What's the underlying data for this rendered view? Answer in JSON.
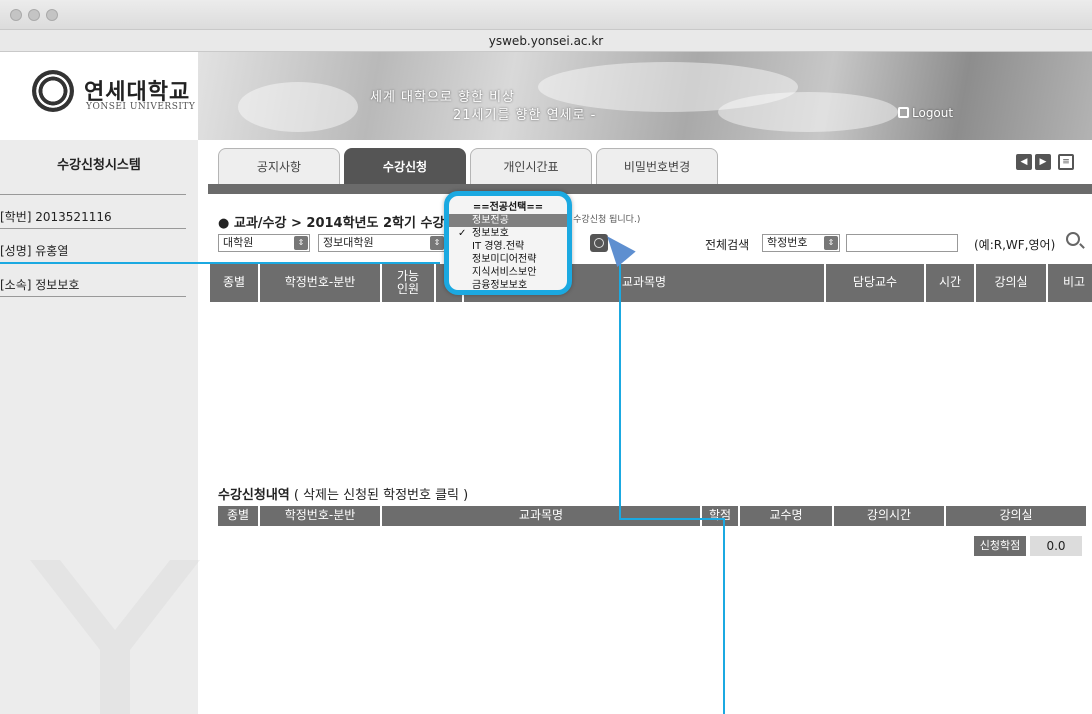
{
  "browser": {
    "url": "ysweb.yonsei.ac.kr"
  },
  "header": {
    "logo_ko": "연세대학교",
    "logo_en": "YONSEI UNIVERSITY",
    "slogan_line1": "세계 대학으로 향한 비상",
    "slogan_line2": "21세기를 향한 연세로 -",
    "logout": "Logout"
  },
  "sidebar": {
    "title": "수강신청시스템",
    "student_id": "[학번] 2013521116",
    "name": "[성명] 유홍열",
    "dept": "[소속] 정보보호"
  },
  "tabs": [
    "공지사항",
    "수강신청",
    "개인시간표",
    "비밀번호변경"
  ],
  "active_tab": "수강신청",
  "breadcrumb": "● 교과/수강 > 2014학년도 2학기 수강",
  "breadcrumb_note": "면 수강신청 됩니다.)",
  "filters": {
    "level": "대학원",
    "school": "정보대학원",
    "search_label": "전체검색",
    "search_type": "학정번호",
    "search_value": "",
    "hint": "(예:R,WF,영어)"
  },
  "course_table": {
    "columns": [
      "종별",
      "학정번호-분반",
      "가능\n인원",
      "",
      "교과목명",
      "담당교수",
      "시간",
      "강의실",
      "비고"
    ]
  },
  "registered": {
    "title": "수강신청내역",
    "subtitle": " ( 삭제는 신청된 학정번호 클릭 )",
    "columns": [
      "종별",
      "학정번호-분반",
      "교과목명",
      "학점",
      "교수명",
      "강의시간",
      "강의실"
    ],
    "credit_label": "신청학점",
    "credit_value": "0.0"
  },
  "major_dropdown": {
    "options": [
      "==전공선택==",
      "정보전공",
      "정보보호",
      "IT 경영.전략",
      "정보미디어전략",
      "지식서비스보안",
      "금융정보보호"
    ],
    "highlighted": "정보전공",
    "checked": "정보보호"
  },
  "colors": {
    "callout": "#1ba9e1",
    "header_gray": "#6d6d6d"
  }
}
